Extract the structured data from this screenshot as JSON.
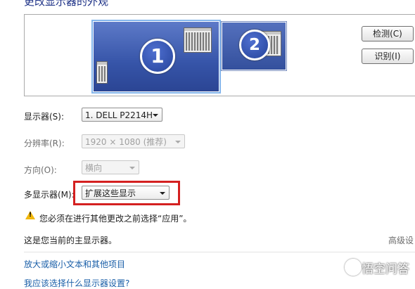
{
  "heading": "更改显示器的外观",
  "monitors": [
    "1",
    "2"
  ],
  "buttons": {
    "detect": "检测(C)",
    "identify": "识别(I)"
  },
  "fields": {
    "display": {
      "label": "显示器(S):",
      "value": "1. DELL P2214H"
    },
    "resolution": {
      "label": "分辨率(R):",
      "value": "1920 × 1080 (推荐)"
    },
    "orientation": {
      "label": "方向(O):",
      "value": "横向"
    },
    "multiple": {
      "label": "多显示器(M):",
      "value": "扩展这些显示"
    }
  },
  "warning": "您必须在进行其他更改之前选择“应用”。",
  "primary_note": "这是您当前的主显示器。",
  "advanced_link": "高级设",
  "links": [
    "放大或缩小文本和其他项目",
    "我应该选择什么显示器设置?"
  ],
  "watermark": "悟空问答",
  "colors": {
    "highlight": "#d42020",
    "link": "#1a5fa8",
    "heading": "#1e3287"
  }
}
